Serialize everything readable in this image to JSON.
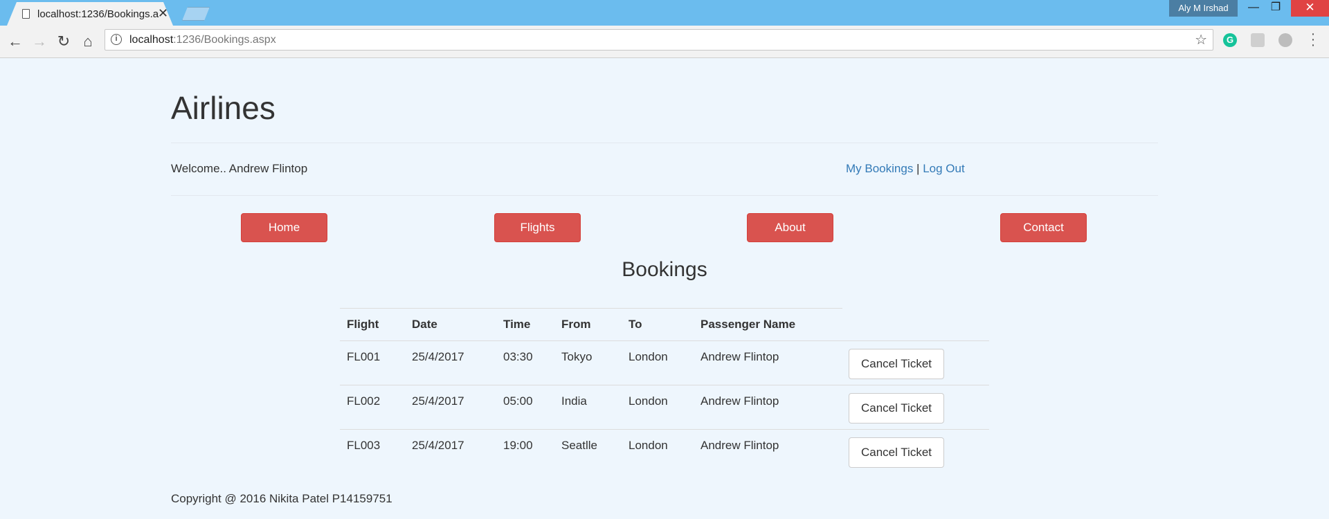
{
  "browser": {
    "tab_title": "localhost:1236/Bookings.aspx",
    "tab_close": "✕",
    "user_badge": "Aly M Irshad",
    "url_host": "localhost",
    "url_rest": ":1236/Bookings.aspx",
    "win_min": "—",
    "win_max": "❐",
    "win_close": "✕",
    "ext_g": "G"
  },
  "site": {
    "title": "Airlines",
    "welcome": "Welcome.. Andrew Flintop",
    "my_bookings": "My Bookings",
    "separator": " | ",
    "logout": "Log Out"
  },
  "nav": {
    "home": "Home",
    "flights": "Flights",
    "about": "About",
    "contact": "Contact"
  },
  "bookings": {
    "heading": "Bookings",
    "columns": [
      "Flight",
      "Date",
      "Time",
      "From",
      "To",
      "Passenger Name"
    ],
    "rows": [
      {
        "flight": "FL001",
        "date": "25/4/2017",
        "time": "03:30",
        "from": "Tokyo",
        "to": "London",
        "passenger": "Andrew Flintop",
        "action": "Cancel Ticket"
      },
      {
        "flight": "FL002",
        "date": "25/4/2017",
        "time": "05:00",
        "from": "India",
        "to": "London",
        "passenger": "Andrew Flintop",
        "action": "Cancel Ticket"
      },
      {
        "flight": "FL003",
        "date": "25/4/2017",
        "time": "19:00",
        "from": "Seatlle",
        "to": "London",
        "passenger": "Andrew Flintop",
        "action": "Cancel Ticket"
      }
    ]
  },
  "footer": {
    "text": "Copyright @ 2016 Nikita Patel P14159751"
  }
}
